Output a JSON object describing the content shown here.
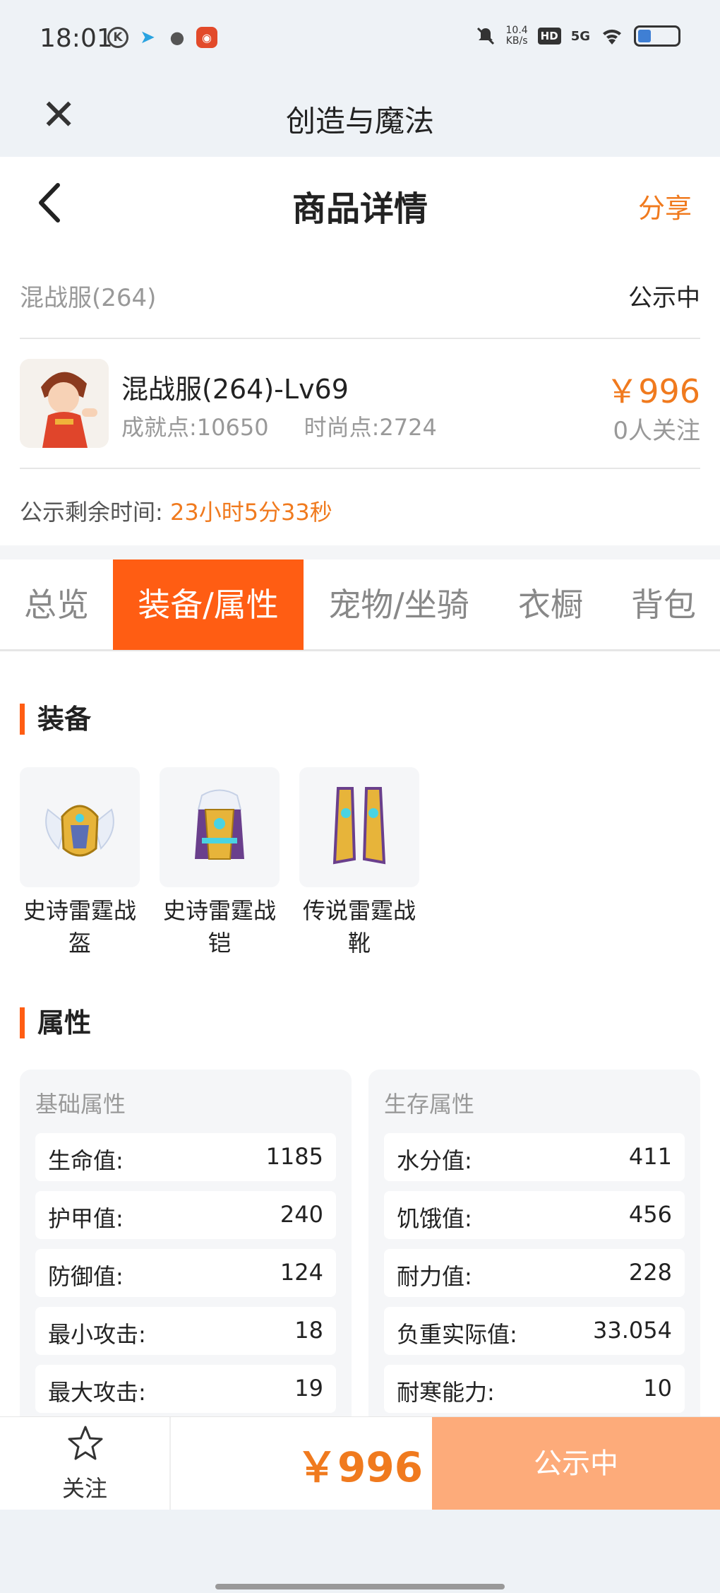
{
  "status_bar": {
    "time": "18:01",
    "speed_top": "10.4",
    "speed_bottom": "KB/s",
    "hd": "HD",
    "network": "5G",
    "icons": [
      "k-icon",
      "telegram-icon",
      "wechat-icon",
      "app-icon",
      "mute-icon",
      "wifi-icon",
      "battery-icon"
    ]
  },
  "webview": {
    "title": "创造与魔法"
  },
  "header": {
    "title": "商品详情",
    "share_label": "分享"
  },
  "server": {
    "name": "混战服(264)",
    "status": "公示中"
  },
  "product": {
    "name": "混战服(264)-Lv69",
    "achievement": "成就点:10650",
    "fashion": "时尚点:2724",
    "price": "￥996",
    "followers": "0人关注"
  },
  "timer": {
    "label": "公示剩余时间:",
    "value": "23小时5分33秒"
  },
  "tabs": [
    {
      "label": "总览",
      "active": false
    },
    {
      "label": "装备/属性",
      "active": true
    },
    {
      "label": "宠物/坐骑",
      "active": false
    },
    {
      "label": "衣橱",
      "active": false
    },
    {
      "label": "背包",
      "active": false
    }
  ],
  "equipment": {
    "title": "装备",
    "items": [
      {
        "line1": "史诗雷霆战",
        "line2": "盔"
      },
      {
        "line1": "史诗雷霆战",
        "line2": "铠"
      },
      {
        "line1": "传说雷霆战",
        "line2": "靴"
      }
    ]
  },
  "attributes": {
    "title": "属性",
    "basic": {
      "title": "基础属性",
      "rows": [
        {
          "key": "生命值:",
          "value": "1185"
        },
        {
          "key": "护甲值:",
          "value": "240"
        },
        {
          "key": "防御值:",
          "value": "124"
        },
        {
          "key": "最小攻击:",
          "value": "18"
        },
        {
          "key": "最大攻击:",
          "value": "19"
        }
      ]
    },
    "survival": {
      "title": "生存属性",
      "rows": [
        {
          "key": "水分值:",
          "value": "411"
        },
        {
          "key": "饥饿值:",
          "value": "456"
        },
        {
          "key": "耐力值:",
          "value": "228"
        },
        {
          "key": "负重实际值:",
          "value": "33.054"
        },
        {
          "key": "耐寒能力:",
          "value": "10"
        }
      ]
    }
  },
  "bottom_bar": {
    "follow_label": "关注",
    "price": "￥996",
    "status_button": "公示中"
  },
  "colors": {
    "accent": "#ff5d13",
    "price": "#f07a1e",
    "disabled_button": "#fdab7a"
  }
}
